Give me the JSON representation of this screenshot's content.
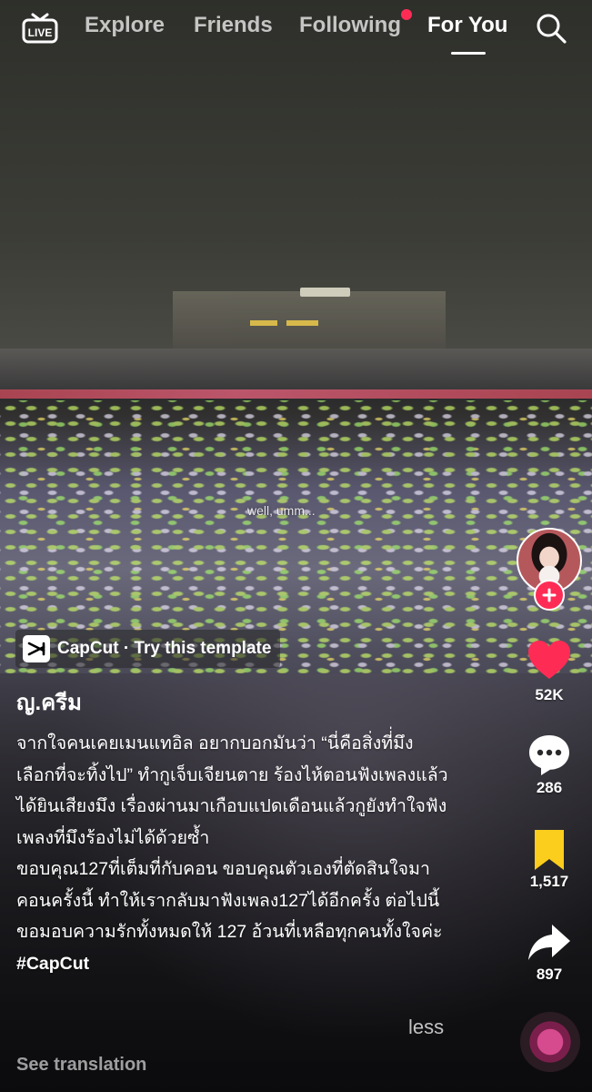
{
  "nav": {
    "live_icon": "live-tv-icon",
    "tabs": [
      {
        "label": "Explore"
      },
      {
        "label": "Friends"
      },
      {
        "label": "Following",
        "has_notification_dot": true
      },
      {
        "label": "For You",
        "active": true
      }
    ],
    "search_icon": "search-icon"
  },
  "video": {
    "overlay_text": "well, umm..."
  },
  "template": {
    "label": "CapCut · Try this template",
    "icon": "capcut-icon"
  },
  "post": {
    "username": "ญ.ครีม",
    "caption_paragraph_1": "จากใจคนเคยเมนแทอิล อยากบอกมันว่า “นี่คือสิ่งที่่มึงเลือกที่จะทิ้งไป” ทำกูเจ็บเจียนตาย ร้องไห้ตอนฟังเพลงแล้วได้ยินเสียงมึง เรื่องผ่านมาเกือบแปดเดือนแล้วกูยังทำใจฟังเพลงที่มึงร้องไม่ได้ด้วยซ้ำ",
    "caption_paragraph_2": "ขอบคุณ127ที่เต็มที่กับคอน ขอบคุณตัวเองที่ตัดสินใจมาคอนครั้งนี้ ทำให้เรากลับมาฟังเพลง127ได้อีกครั้ง ต่อไปนี้ขอมอบความรักทั้งหมดให้ 127 อ้วนที่เหลือทุกคนทั้งใจค่ะ",
    "hashtag": "#CapCut",
    "less_label": "less",
    "see_translation_label": "See translation"
  },
  "actions": {
    "likes": "52K",
    "comments": "286",
    "saves": "1,517",
    "shares": "897"
  },
  "colors": {
    "accent": "#fe2c55",
    "save_yellow": "#fbcd1c",
    "notification": "#fe2c55"
  }
}
